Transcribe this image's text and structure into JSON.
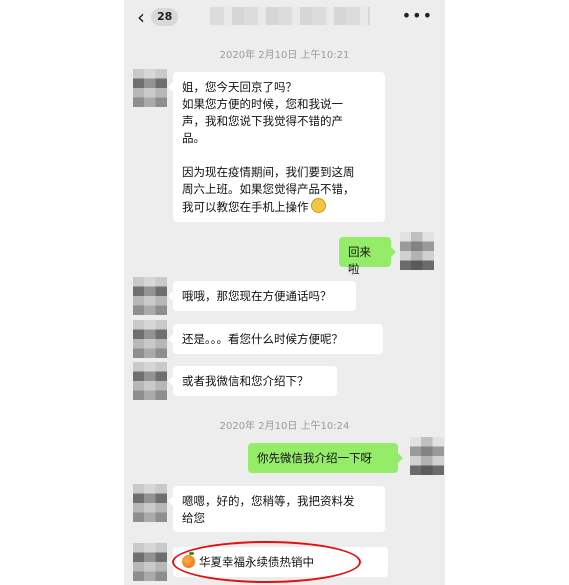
{
  "topbar": {
    "back_count": "28",
    "contact_name": "",
    "more_icon": "more-icon"
  },
  "timestamps": [
    "2020年 2月10日 上午10:21",
    "2020年 2月10日 上午10:24"
  ],
  "messages": [
    {
      "side": "left",
      "text": "姐，您今天回京了吗？\n如果您方便的时候，您和我说一\n声，我和您说下我觉得不错的产\n品。\n\n因为现在疫情期间，我们要到这周\n周六上班。如果您觉得产品不错，\n我可以教您在手机上操作"
    },
    {
      "side": "right",
      "text": "回来啦"
    },
    {
      "side": "left",
      "text": "哦哦，那您现在方便通话吗？"
    },
    {
      "side": "left",
      "text": "还是。。。看您什么时候方便呢？"
    },
    {
      "side": "left",
      "text": "或者我微信和您介绍下？"
    },
    {
      "side": "right",
      "text": "你先微信我介绍一下呀"
    },
    {
      "side": "left",
      "text": "嗯嗯，好的，您稍等，我把资料发\n给您"
    },
    {
      "side": "left",
      "text": "华夏幸福永续债热销中"
    }
  ],
  "colors": {
    "sent_bubble": "#95ec69",
    "received_bubble": "#ffffff",
    "annotation": "#e60f0f"
  }
}
